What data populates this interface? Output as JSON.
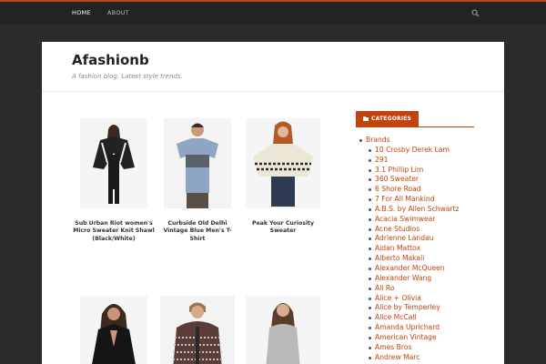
{
  "nav": {
    "items": [
      "HOME",
      "ABOUT"
    ]
  },
  "site": {
    "title": "Afashionb",
    "description": "A fashion blog. Latest style trends."
  },
  "products": [
    "Sub Urban Riot women's Micro Sweater Knit Shawl (Black/White)",
    "Curbside Old Delhi Vintage Blue Men's T-Shirt",
    "Peak Your Curiosity Sweater",
    "",
    "",
    ""
  ],
  "sidebar": {
    "categories_label": "CATEGORIES",
    "parent": "Brands",
    "brands": [
      "10 Crosby Derek Lam",
      "291",
      "3.1 Phillip Lim",
      "360 Sweater",
      "6 Shore Road",
      "7 For All Mankind",
      "A.B.S. by Allen Schwartz",
      "Acacia Swimwear",
      "Acne Studios",
      "Adrienne Landau",
      "Aidan Mattox",
      "Alberto Makali",
      "Alexander McQueen",
      "Alexander Wang",
      "Ali Ro",
      "Alice + Olivia",
      "Alice by Temperley",
      "Alice McCall",
      "Amanda Uprichard",
      "American Vintage",
      "Ames Bros",
      "Andrew Marc"
    ]
  },
  "colors": {
    "accent": "#c1440e",
    "topbar": "#232323",
    "background": "#2b2b2b"
  },
  "icons": {
    "search": "search-icon",
    "category": "folder-icon"
  }
}
